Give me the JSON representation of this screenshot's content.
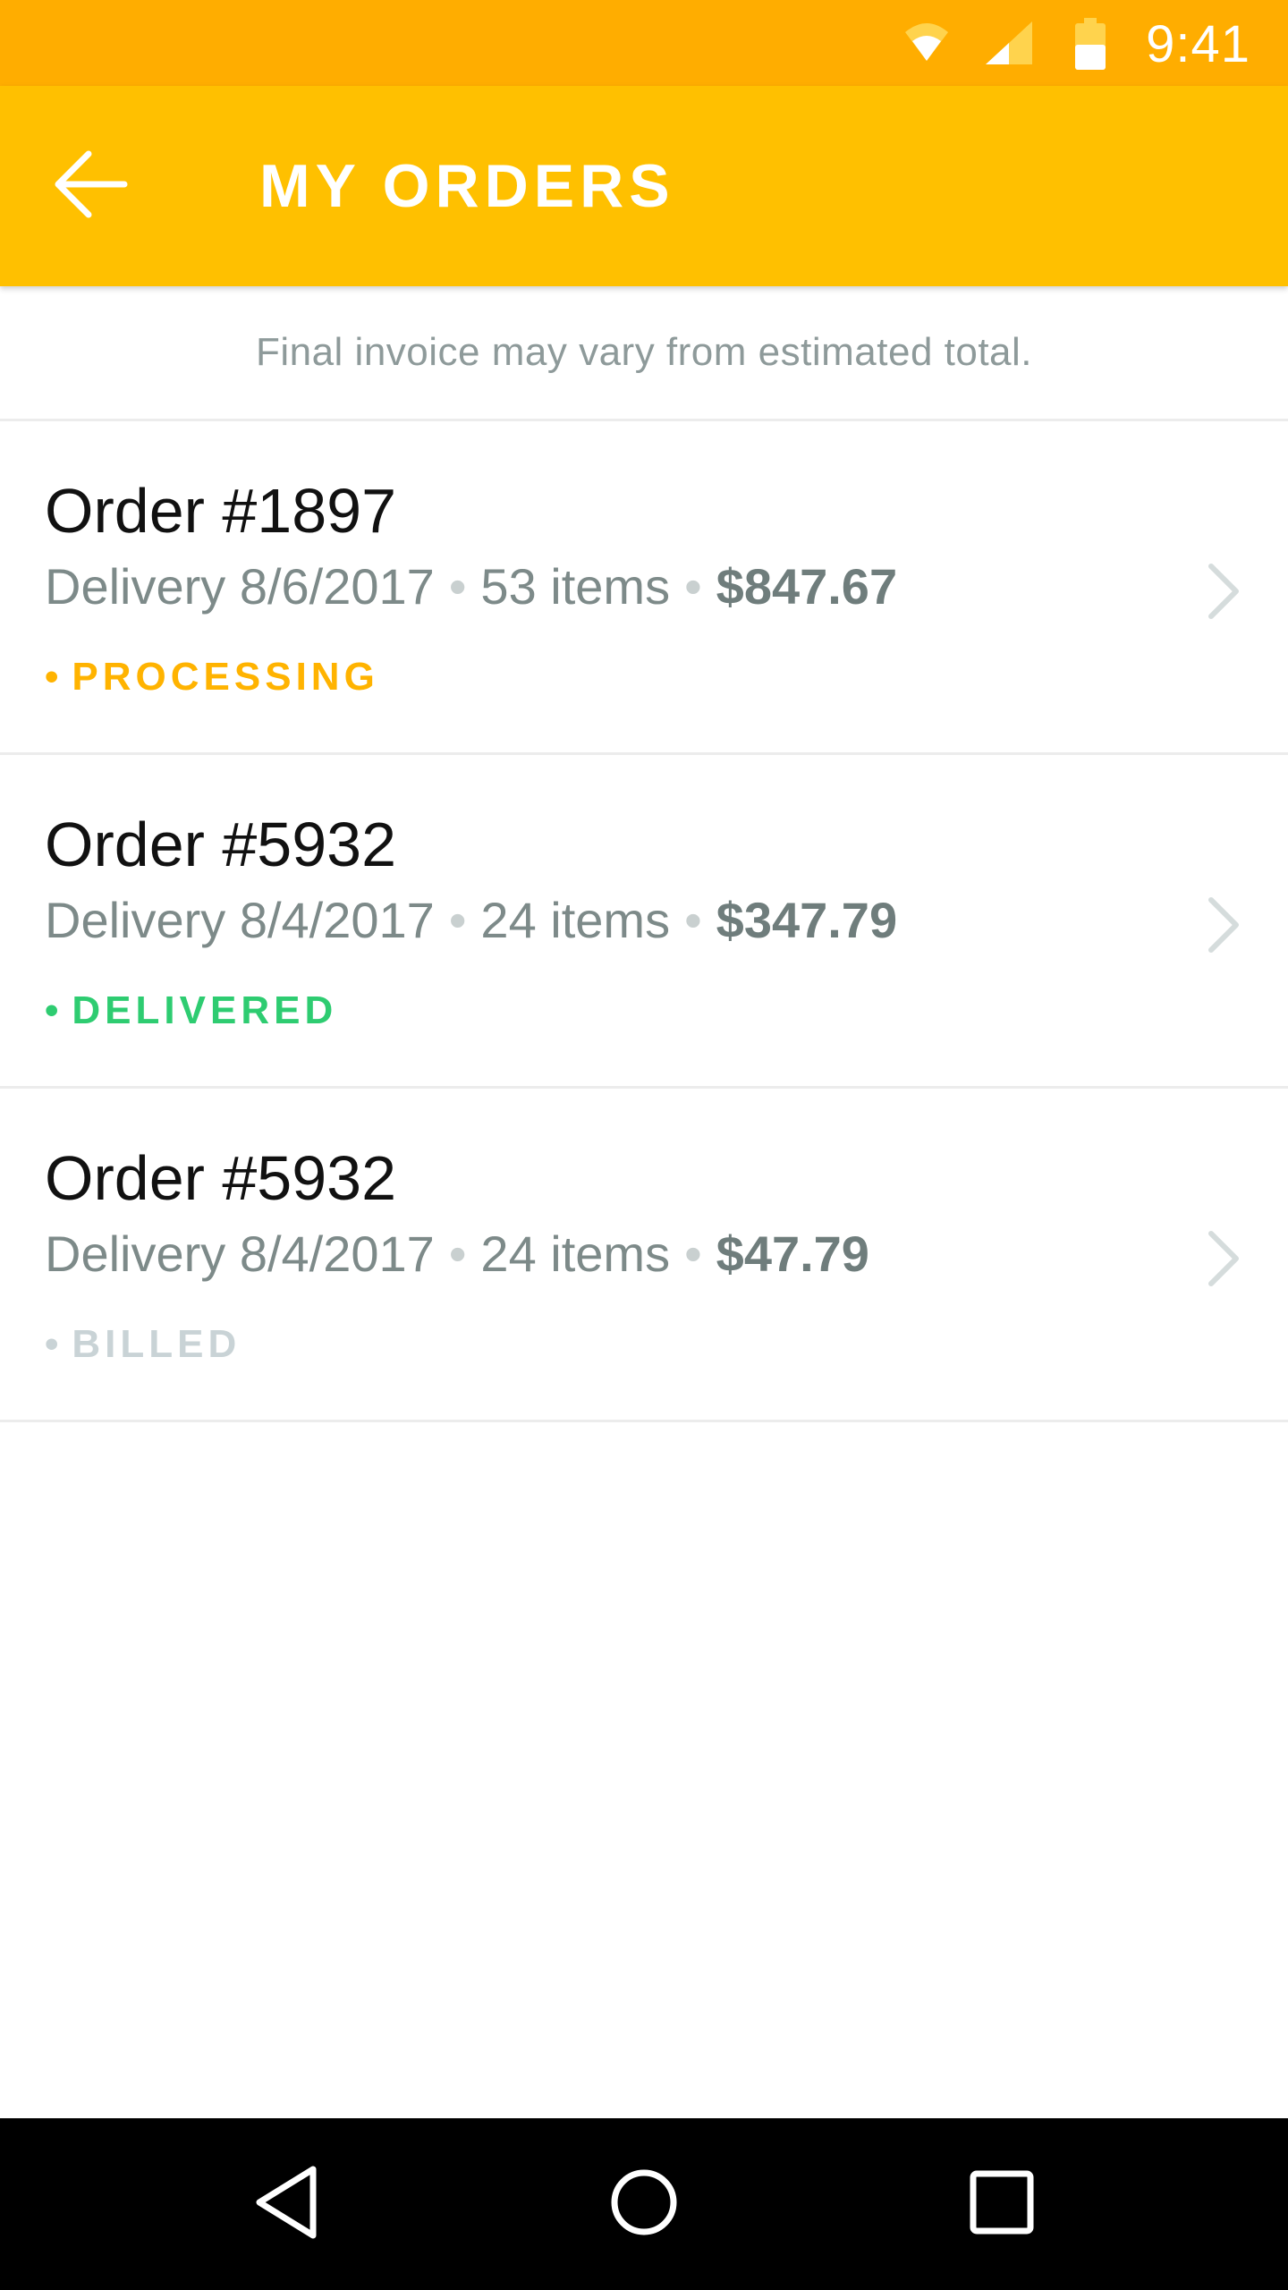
{
  "status_bar": {
    "time": "9:41",
    "icons": [
      "wifi-icon",
      "cellular-signal-icon",
      "battery-icon"
    ]
  },
  "app_bar": {
    "back_icon": "arrow-left-icon",
    "title": "MY ORDERS"
  },
  "notice": {
    "text": "Final invoice may vary from estimated total."
  },
  "orders": [
    {
      "title": "Order #1897",
      "delivery": "Delivery 8/6/2017",
      "items": "53 items",
      "total": "$847.67",
      "status": "PROCESSING",
      "status_color": "#FFB300"
    },
    {
      "title": "Order #5932",
      "delivery": "Delivery 8/4/2017",
      "items": "24 items",
      "total": "$347.79",
      "status": "DELIVERED",
      "status_color": "#2ECC71"
    },
    {
      "title": "Order #5932",
      "delivery": "Delivery 8/4/2017",
      "items": "24 items",
      "total": "$47.79",
      "status": "BILLED",
      "status_color": "#C9D3D6"
    }
  ],
  "nav_bar": {
    "back_icon": "triangle-back-icon",
    "home_icon": "circle-home-icon",
    "recents_icon": "square-recents-icon"
  },
  "colors": {
    "status_bar": "#FFAD00",
    "app_bar": "#FFC000",
    "meta_text": "#7D8A89",
    "divider": "#ECECEC"
  }
}
